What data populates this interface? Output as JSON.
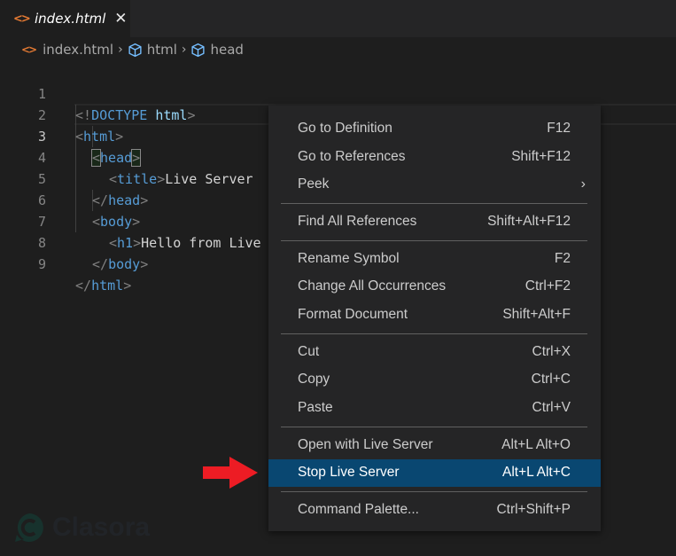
{
  "tab": {
    "file_icon": "html-file-icon",
    "name": "index.html",
    "close_icon": "✕"
  },
  "breadcrumb": {
    "file": "index.html",
    "items": [
      "html",
      "head"
    ],
    "separator": "›"
  },
  "editor": {
    "current_line": 3,
    "lines": [
      {
        "n": "1"
      },
      {
        "n": "2"
      },
      {
        "n": "3"
      },
      {
        "n": "4"
      },
      {
        "n": "5"
      },
      {
        "n": "6"
      },
      {
        "n": "7"
      },
      {
        "n": "8"
      },
      {
        "n": "9"
      }
    ],
    "tokens": {
      "l1": [
        "<!",
        "DOCTYPE",
        " ",
        "html",
        ">"
      ],
      "l2": [
        "<",
        "html",
        ">"
      ],
      "l3": [
        "<",
        "head",
        ">"
      ],
      "l4": [
        "<",
        "title",
        ">",
        "Live Server"
      ],
      "l5": [
        "</",
        "head",
        ">"
      ],
      "l6": [
        "<",
        "body",
        ">"
      ],
      "l7": [
        "<",
        "h1",
        ">",
        "Hello from Live"
      ],
      "l8": [
        "</",
        "body",
        ">"
      ],
      "l9": [
        "</",
        "html",
        ">"
      ]
    }
  },
  "context_menu": {
    "groups": [
      [
        {
          "label": "Go to Definition",
          "shortcut": "F12"
        },
        {
          "label": "Go to References",
          "shortcut": "Shift+F12"
        },
        {
          "label": "Peek",
          "shortcut": "",
          "submenu": true
        }
      ],
      [
        {
          "label": "Find All References",
          "shortcut": "Shift+Alt+F12"
        }
      ],
      [
        {
          "label": "Rename Symbol",
          "shortcut": "F2"
        },
        {
          "label": "Change All Occurrences",
          "shortcut": "Ctrl+F2"
        },
        {
          "label": "Format Document",
          "shortcut": "Shift+Alt+F"
        }
      ],
      [
        {
          "label": "Cut",
          "shortcut": "Ctrl+X"
        },
        {
          "label": "Copy",
          "shortcut": "Ctrl+C"
        },
        {
          "label": "Paste",
          "shortcut": "Ctrl+V"
        }
      ],
      [
        {
          "label": "Open with Live Server",
          "shortcut": "Alt+L Alt+O"
        },
        {
          "label": "Stop Live Server",
          "shortcut": "Alt+L Alt+C",
          "selected": true
        }
      ],
      [
        {
          "label": "Command Palette...",
          "shortcut": "Ctrl+Shift+P"
        }
      ]
    ],
    "submenu_chevron": "›"
  },
  "annotation": {
    "arrow_color": "#ed1c24",
    "points_to": "Stop Live Server"
  },
  "watermark": {
    "text": "Clasora"
  },
  "colors": {
    "selection": "#094771",
    "html_icon": "#e37933",
    "symbol_icon": "#75beff"
  }
}
